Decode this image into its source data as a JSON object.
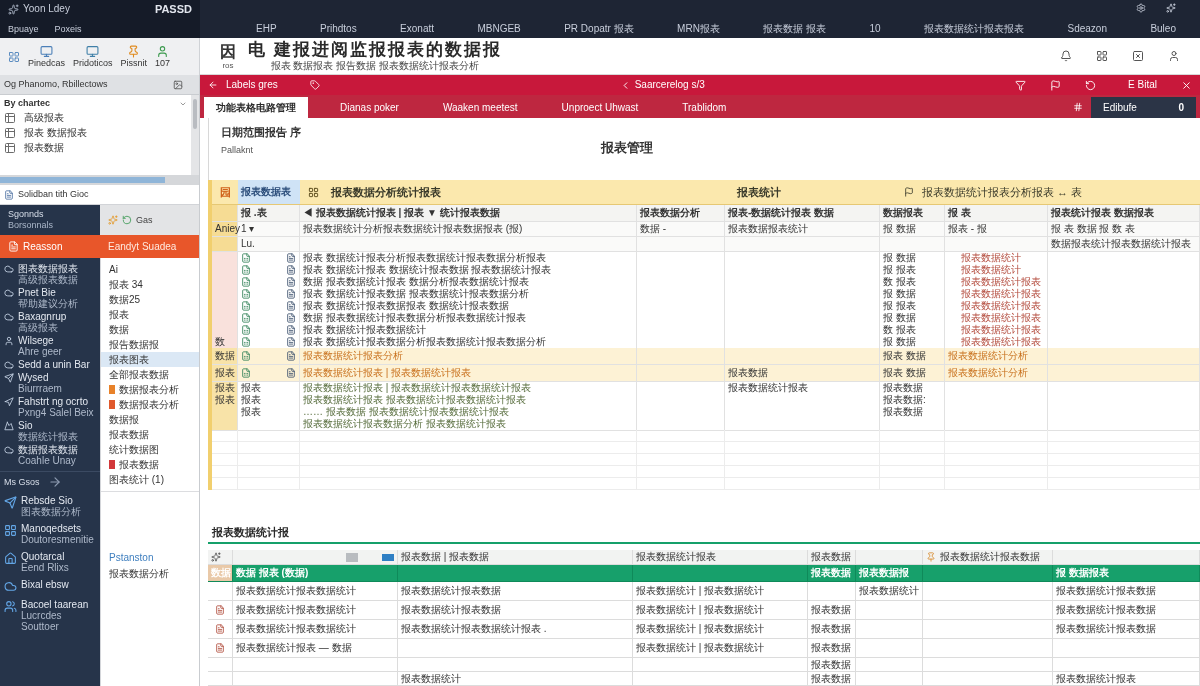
{
  "title_bar": {
    "app_name": "Yoon Ldey",
    "document": "PASSD",
    "links": [
      "Bpuaye",
      "Poxeis"
    ],
    "menu": [
      "EHP",
      "Prihdtos",
      "Exonatt",
      "MBNGEB",
      "PR Dopatr 报表",
      "MRN报表",
      "报表数据 报表",
      "10",
      "报表数据统计报表报表",
      "Sdeazon",
      "Buleo"
    ]
  },
  "ribbon": {
    "buttons": [
      "Pinedcas",
      "Pridoticos",
      "Pissnit",
      "107"
    ]
  },
  "header": {
    "mark": "因",
    "code": "ros",
    "title": "电 建报进阅监报报表的数据报",
    "subtitle": "报表 数据报表 报告数据 报表数据统计报表分析"
  },
  "panel": {
    "bar": "Og Phanomo, Rbillectows",
    "title": "By chartec",
    "items": [
      "高级报表",
      "报表 数据报表",
      "报表数据"
    ],
    "footer": "Solidban tith Gioc"
  },
  "nav": {
    "top": {
      "label": "Sgonnds",
      "sub": "Borsonnals"
    },
    "tool": "Gas",
    "band": {
      "label": "Reasson",
      "detail": "Eandyt Suadea",
      "selected": true
    },
    "items": [
      {
        "label": "图表数据报表",
        "sub": "高级报表数据"
      },
      {
        "label": "Pnet Bie",
        "sub": "帮助建议分析"
      },
      {
        "label": "Baxagnrup",
        "sub": "高级报表"
      },
      {
        "label": "Wilsege",
        "sub": "Ahre geer"
      },
      {
        "label": "Sedd a unin Bar"
      },
      {
        "label": "Wysed",
        "sub": "Biurrraem"
      },
      {
        "label": "Fahstrt ng ocrto",
        "sub": "Pxng4 Salel Beix"
      },
      {
        "label": "Sio",
        "sub": "数据统计报表"
      },
      {
        "label": "数据报表数据",
        "sub": "Coahle Unay"
      }
    ],
    "section": "Ms Gsos",
    "links": [
      {
        "label": "Rebsde Sio",
        "sub": "图表数据分析"
      },
      {
        "label": "Manoqedsets",
        "sub": "Doutoresmenitie"
      },
      {
        "label": "Quotarcal",
        "sub": "Eend Rlixs"
      },
      {
        "label": "Bixal ebsw"
      },
      {
        "label": "Bacoel taarean",
        "sub": "Lucrcdes Souttoer"
      }
    ]
  },
  "list": {
    "items": [
      {
        "label": "Ai",
        "selected": false
      },
      {
        "label": "报表 34",
        "selected": false
      },
      {
        "label": "数据25",
        "selected": false
      },
      {
        "label": "报表",
        "selected": false
      },
      {
        "label": "数据",
        "selected": false
      },
      {
        "label": "报告数据报",
        "selected": false
      },
      {
        "label": "报表图表",
        "selected": true
      },
      {
        "label": "全部报表数据",
        "selected": false
      },
      {
        "label": "数据报表分析",
        "selected": false,
        "color": "#e8822a"
      },
      {
        "label": "数据报表分析",
        "selected": false,
        "color": "#e0592c"
      },
      {
        "label": "数据报",
        "selected": false
      },
      {
        "label": "报表数据",
        "selected": false
      },
      {
        "label": "统计数据图",
        "selected": false
      },
      {
        "label": "报表数据",
        "selected": false,
        "color": "#d2383a"
      },
      {
        "label": "图表统计 (1)",
        "selected": false
      }
    ],
    "section": "Pstanston",
    "section_items": [
      "报表数据分析"
    ]
  },
  "toolbar": {
    "back": "Labels gres",
    "breadcrumb": "Saarcerelog s/3",
    "action": "E Bital"
  },
  "tabs": [
    {
      "label": "功能表格电路管理",
      "selected": true
    },
    {
      "label": "Dianas poker",
      "selected": false
    },
    {
      "label": "Waaken meetest",
      "selected": false
    },
    {
      "label": "Unproect Uhwast",
      "selected": false
    },
    {
      "label": "Trablidom",
      "selected": false
    }
  ],
  "editor_badge": {
    "label": "Edibufe",
    "count": "0"
  },
  "report": {
    "title": "日期范围报告 序",
    "author": "Pallaknt",
    "heading": "报表管理"
  },
  "table": {
    "title_row": {
      "marker": "园",
      "tab": "报表数据表",
      "title": "报表数据分析统计报表",
      "group_1": "报表统计",
      "group_2": "报表数据统计报表分析报表 ↔ 表"
    },
    "rows": [
      {
        "kind": "heading",
        "column_2": "报 .表",
        "column_3": "◀ 报表数据统计报表 | 报表 ▼ 统计报表数据",
        "column_4": "报表数据分析",
        "column_5": "报表-数据统计报表 数据",
        "column_6": "数据报表",
        "column_7": "报 表",
        "column_8": "报表统计报表 数据报表"
      },
      {
        "kind": "subheading",
        "column_1": "Aniey",
        "column_2": "1 ▾",
        "column_3": "报表数据统计分析报表数据统计报表数据报表 (报)",
        "column_4": "数据 -",
        "column_5": "报表数据报表统计",
        "column_6": "报 数据",
        "column_7": "报表 - 报",
        "column_8": "报 表 数据 报 数 表"
      },
      {
        "kind": "subheading",
        "column_2": "Lu.",
        "column_8": "数据报表统计报表数据统计报表"
      },
      {
        "kind": "data",
        "column_3": "报表 数据统计报表分析报表数据统计报表数据分析报表",
        "column_6": "报 数据",
        "column_7": "报表数据统计"
      },
      {
        "kind": "data",
        "column_3": "报表 数据统计报表 数据统计报表数据 报表数据统计报表",
        "column_6": "报 报表",
        "column_7": "报表数据统计"
      },
      {
        "kind": "data",
        "column_3": "数据 报表数据统计报表 数据分析报表数据统计报表",
        "column_6": "数 报表",
        "column_7": "报表数据统计报表"
      },
      {
        "kind": "data",
        "column_3": "报表 数据统计报表数据 报表数据统计报表数据分析",
        "column_6": "报 数据",
        "column_7": "报表数据统计报表"
      },
      {
        "kind": "data",
        "column_3": "报表 数据统计报表数据报表 数据统计报表数据",
        "column_6": "报 报表",
        "column_7": "报表数据统计报表"
      },
      {
        "kind": "data",
        "column_3": "数据 报表数据统计报表数据分析报表数据统计报表",
        "column_6": "报 数据",
        "column_7": "报表数据统计报表"
      },
      {
        "kind": "data",
        "column_3": "报表 数据统计报表数据统计",
        "column_6": "数 报表",
        "column_7": "报表数据统计报表"
      },
      {
        "kind": "data",
        "column_1": "数",
        "column_3": "报表 数据统计报表数据分析报表数据统计报表数据分析",
        "column_6": "报 数据",
        "column_7": "报表数据统计报表"
      },
      {
        "kind": "highlight",
        "column_1": "数据",
        "column_3": "报表数据统计报表分析",
        "column_6": "报表 数据",
        "column_7": "报表数据统计分析"
      },
      {
        "kind": "highlight",
        "column_1": "报表",
        "column_3": "报表数据统计报表 | 报表数据统计报表",
        "column_5": "报表数据",
        "column_6": "报表 数据",
        "column_7": "报表数据统计分析"
      },
      {
        "kind": "detail",
        "column_1": "报表",
        "column_2": "报表",
        "column_3": "报表数据统计报表 | 报表数据统计报表数据统计报表",
        "column_5": "报表数据统计报表",
        "column_6": "报表数据"
      },
      {
        "kind": "detail",
        "column_1": "报表",
        "column_2": "报表",
        "column_3": "报表数据统计报表 报表数据统计报表数据统计报表",
        "column_6": "报表数据:"
      },
      {
        "kind": "detail",
        "column_2": "报表",
        "column_3": "…… 报表数据 报表数据统计报表数据统计报表",
        "column_6": "报表数据"
      },
      {
        "kind": "detail",
        "column_3": "报表数据统计报表数据分析 报表数据统计报表"
      }
    ]
  },
  "summary": {
    "title": "报表数据统计报",
    "toolbar": {
      "column_3": "报表数据 | 报表数据",
      "column_4": "报表数据统计报表",
      "column_5": "报表数据",
      "column_7": "报表数据统计报表数据"
    },
    "header": {
      "column_1": "数据",
      "column_2": "数据 报表 (数据)",
      "column_5": "报表数据",
      "column_6": "报表数据报",
      "column_8": "报 数据报表"
    },
    "rows": [
      {
        "kind": "plain",
        "column_2": "报表数据统计报表数据统计",
        "column_3": "报表数据统计报表数据",
        "column_4": "报表数据统计 | 报表数据统计",
        "column_6": "报表数据统计",
        "column_8": "报表数据统计报表数据"
      },
      {
        "kind": "file",
        "column_2": "报表数据统计报表数据统计",
        "column_3": "报表数据统计报表数据",
        "column_4": "报表数据统计 | 报表数据统计",
        "column_5": "报表数据",
        "column_8": "报表数据统计报表数据"
      },
      {
        "kind": "file",
        "column_2": "报表数据统计报表数据统计",
        "column_3": "报表数据统计报表数据统计报表 .",
        "column_4": "报表数据统计 | 报表数据统计",
        "column_5": "报表数据",
        "column_8": "报表数据统计报表数据"
      },
      {
        "kind": "file",
        "column_2": "报表数据统计报表 — 数据",
        "column_4": "报表数据统计 | 报表数据统计",
        "column_5": "报表数据"
      }
    ],
    "footer_rows": [
      {
        "column_5": "报表数据"
      },
      {
        "column_3": "报表数据统计",
        "column_5": "报表数据",
        "column_8": "报表数据统计报表"
      }
    ]
  }
}
